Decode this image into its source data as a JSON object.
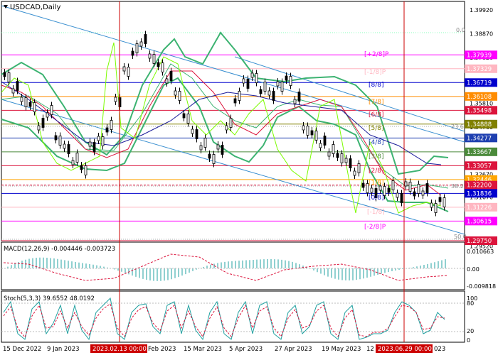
{
  "window": {
    "symbol_title": "USDCAD,Daily"
  },
  "price_axis": {
    "scale_labels": [
      "1.39920",
      "1.38870",
      "1.37820",
      "1.36770",
      "1.35810",
      "1.34760",
      "1.33720",
      "1.32670",
      "1.31670",
      "1.30570",
      "1.29520"
    ],
    "tags": [
      {
        "value": "1.37939",
        "color": "#ff00ff"
      },
      {
        "value": "1.37329",
        "color": "#ffb6c1"
      },
      {
        "value": "1.36719",
        "color": "#0000cd"
      },
      {
        "value": "1.36108",
        "color": "#ff8c00"
      },
      {
        "value": "1.35498",
        "color": "#dc143c"
      },
      {
        "value": "1.34888",
        "color": "#808000"
      },
      {
        "value": "1.34277",
        "color": "#1e3fb0"
      },
      {
        "value": "1.33667",
        "color": "#4a8a3a"
      },
      {
        "value": "1.33057",
        "color": "#dc143c"
      },
      {
        "value": "1.32446",
        "color": "#ffa500"
      },
      {
        "value": "1.32200",
        "color": "#dc143c"
      },
      {
        "value": "1.31836",
        "color": "#0000cd"
      },
      {
        "value": "1.31226",
        "color": "#ffb6c1"
      },
      {
        "value": "1.30615",
        "color": "#ff00ff"
      },
      {
        "value": "1.29750",
        "color": "#dc143c"
      }
    ]
  },
  "murrey_labels": [
    "[+2/8]P",
    "[-1/8]P",
    "[8/8]",
    "[7/8]",
    "[6/8]",
    "[5/8]",
    "[4/8]",
    "[3/8]",
    "[2/8]",
    "[1/8]",
    "[0/8]",
    "[-1/8]",
    "[-2/8]P"
  ],
  "fib_labels": [
    "0.0",
    "23.6",
    "38.2",
    "50.0"
  ],
  "macd": {
    "title": "MACD(12,26,9) -0.004446 -0.003723",
    "scale": [
      "0.010663",
      "0.00",
      "-0.009818"
    ]
  },
  "stoch": {
    "title": "Stoch(5,3,3) 39.6552 48.0192",
    "scale": [
      "100",
      "80",
      "20",
      "0"
    ]
  },
  "time_axis": {
    "labels": [
      "15 Dec 2022",
      "9 Jan 2023",
      "2023.02.13 00:00",
      "Feb 2023",
      "15 Mar 2023",
      "5 Apr 2023",
      "27 Apr 2023",
      "19 May 2023",
      "12",
      "2023.06.29 00:00",
      "023"
    ]
  },
  "colors": {
    "crosshair": "#cc0000",
    "price_line": "#ff0000",
    "bands": "#3cb371",
    "macd_signal": "#dc143c",
    "macd_hist": "#20a0a0",
    "stoch_main": "#20a0a0",
    "stoch_signal": "#dc143c"
  },
  "icons": [
    "dropdown-arrow-icon"
  ]
}
